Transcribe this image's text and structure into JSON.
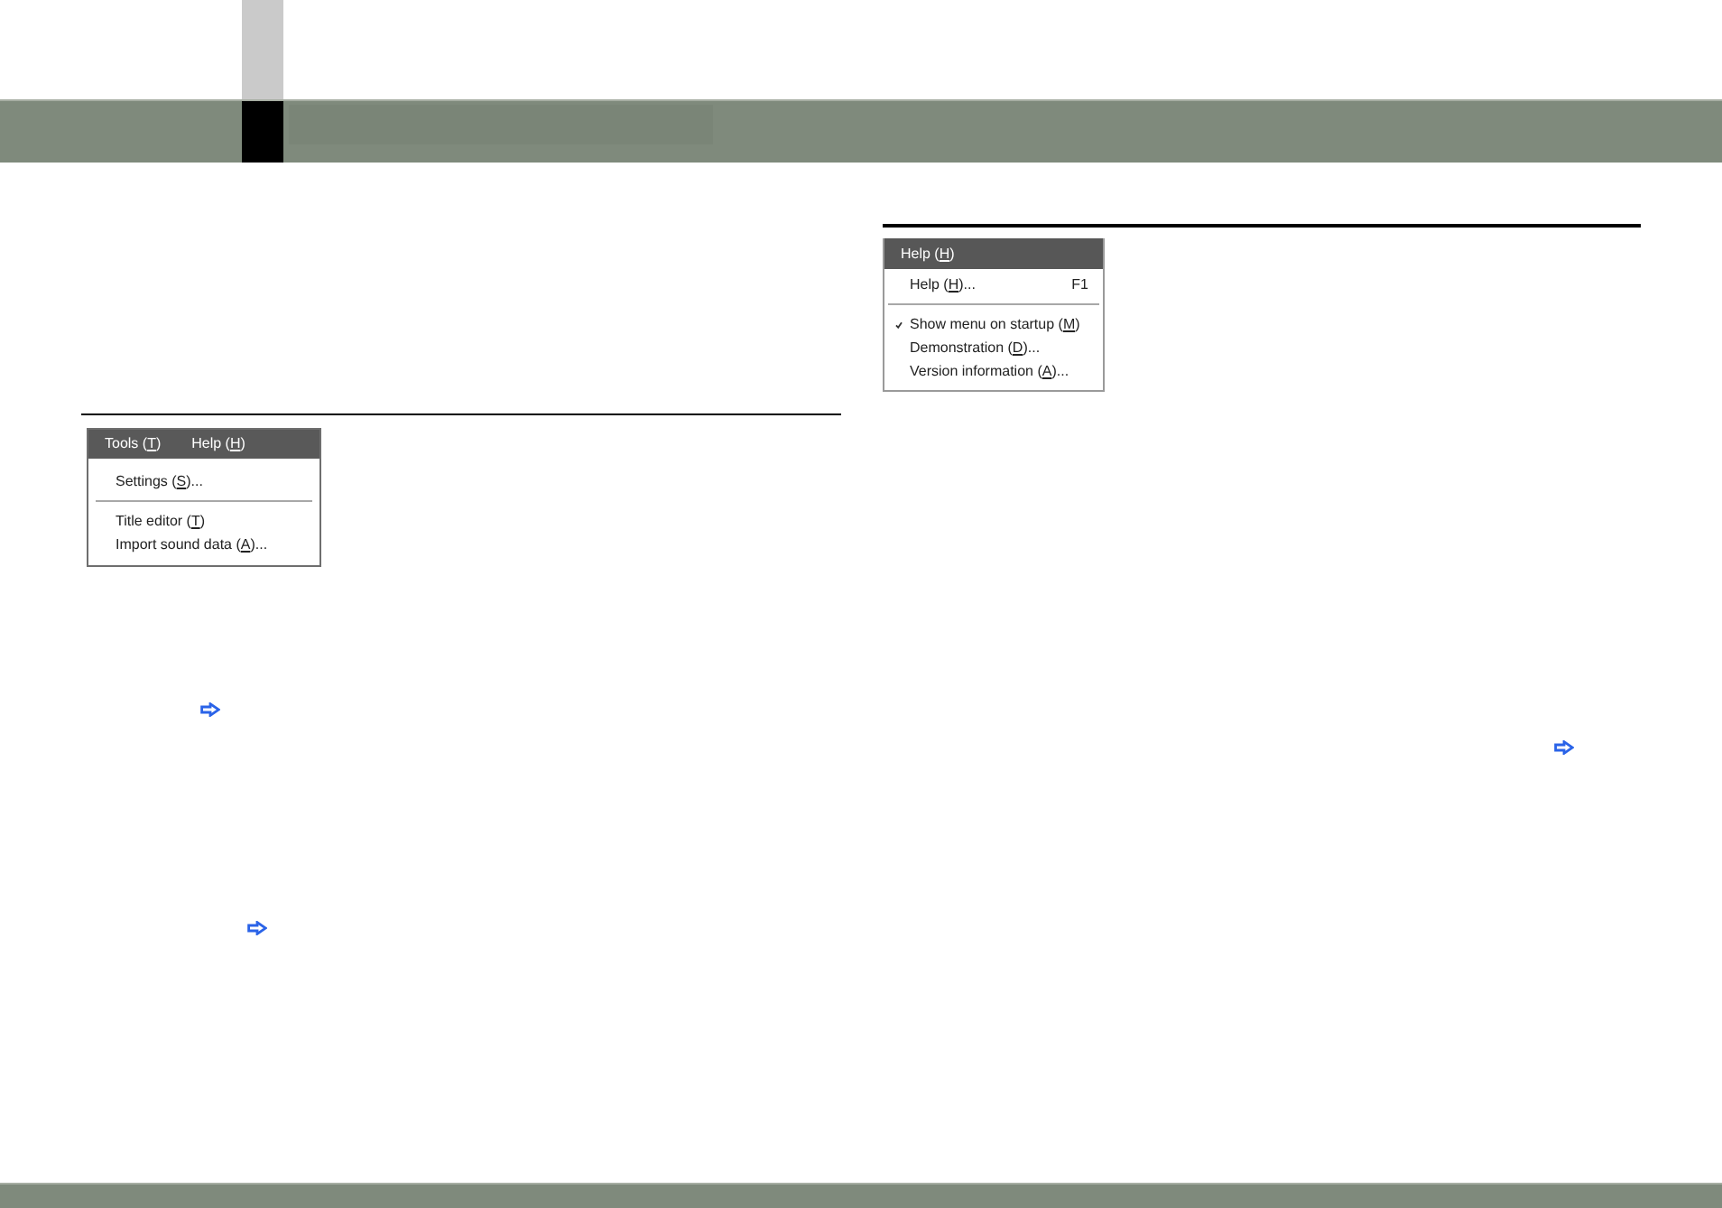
{
  "left_panel": {
    "menu": {
      "kind": "menubar",
      "titles": [
        {
          "label_before": "Tools (",
          "access_key": "T",
          "label_after": ")"
        },
        {
          "label_before": "Help (",
          "access_key": "H",
          "label_after": ")"
        }
      ],
      "items": [
        {
          "kind": "item",
          "label_before": "Settings (",
          "access_key": "S",
          "label_after": ")...",
          "checked": false
        },
        {
          "kind": "separator"
        },
        {
          "kind": "item",
          "label_before": "Title editor (",
          "access_key": "T",
          "label_after": ")",
          "checked": false
        },
        {
          "kind": "item",
          "label_before": "Import sound data (",
          "access_key": "A",
          "label_after": ")...",
          "checked": false
        }
      ]
    }
  },
  "right_panel": {
    "menu": {
      "kind": "dropdown",
      "titles": [
        {
          "label_before": "Help (",
          "access_key": "H",
          "label_after": ")"
        }
      ],
      "items": [
        {
          "kind": "item",
          "label_before": "Help (",
          "access_key": "H",
          "label_after": ")...",
          "shortcut": "F1",
          "checked": false
        },
        {
          "kind": "separator"
        },
        {
          "kind": "item",
          "label_before": "Show menu on startup (",
          "access_key": "M",
          "label_after": ")",
          "checked": true
        },
        {
          "kind": "item",
          "label_before": "Demonstration (",
          "access_key": "D",
          "label_after": ")...",
          "checked": false
        },
        {
          "kind": "item",
          "label_before": "Version information (",
          "access_key": "A",
          "label_after": ")...",
          "checked": false
        }
      ]
    }
  }
}
